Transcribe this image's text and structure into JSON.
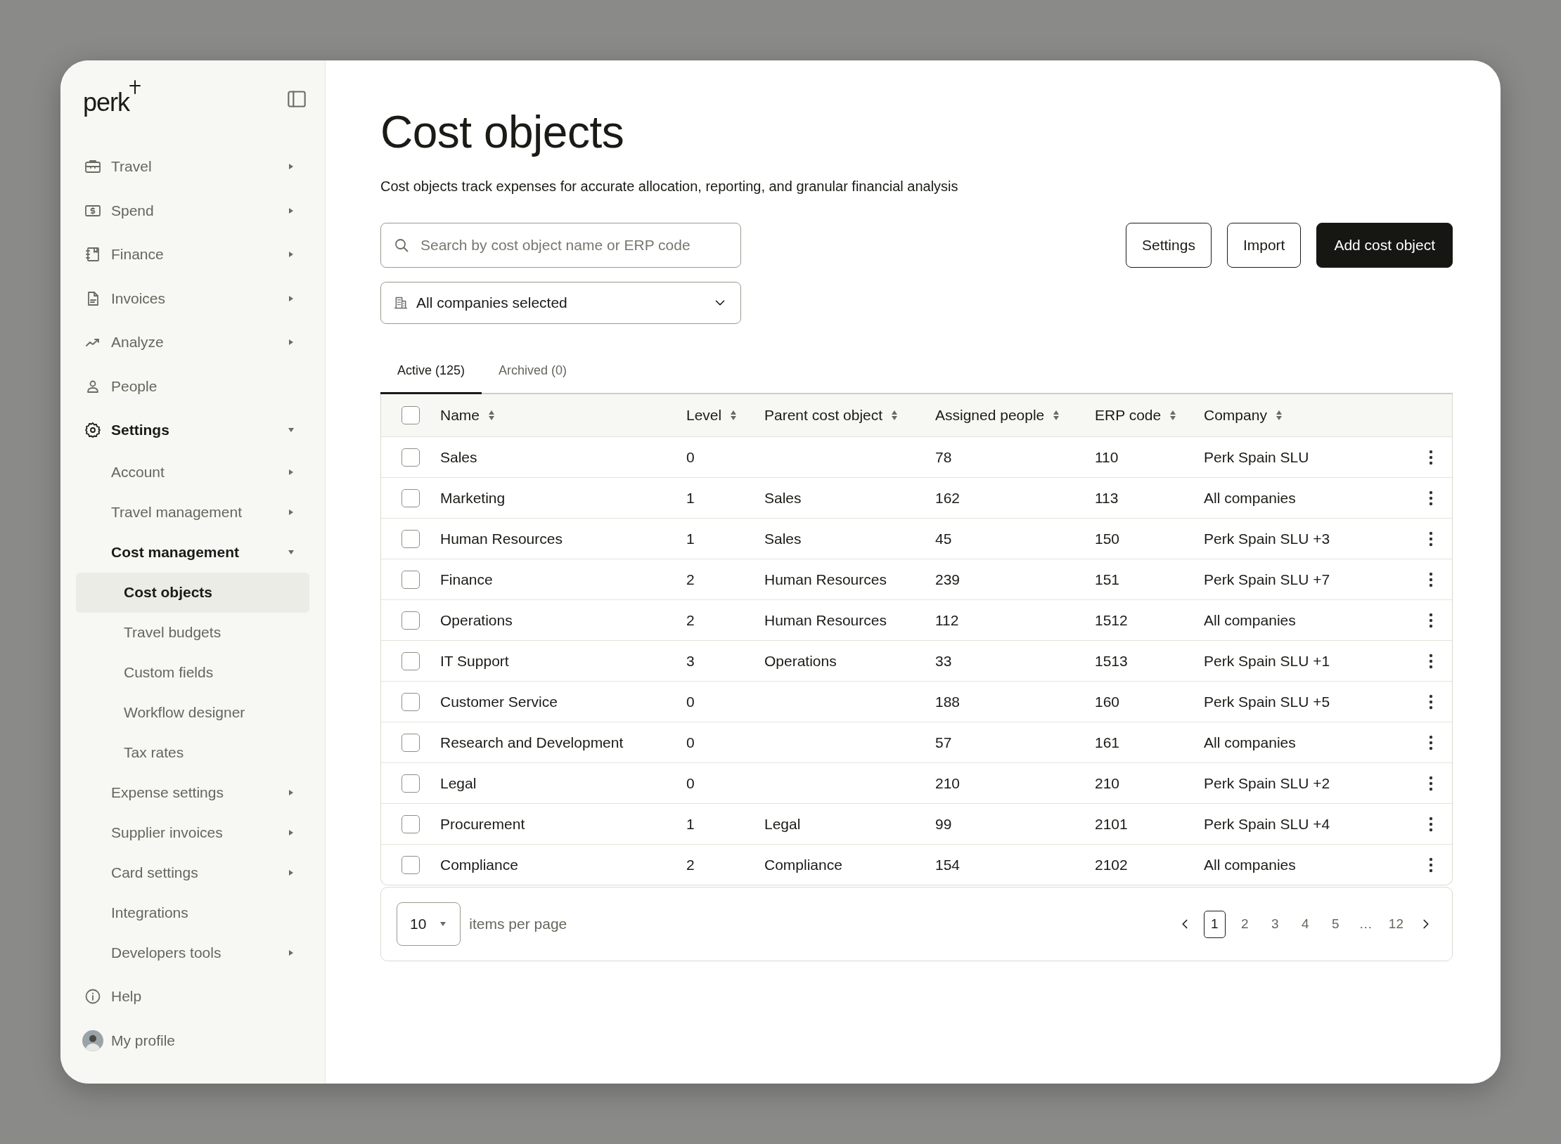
{
  "sidebar": {
    "logo": "perk",
    "items": [
      {
        "label": "Travel",
        "expanded": false,
        "selected": false
      },
      {
        "label": "Spend",
        "expanded": false,
        "selected": false
      },
      {
        "label": "Finance",
        "expanded": false,
        "selected": false
      },
      {
        "label": "Invoices",
        "expanded": false,
        "selected": false
      },
      {
        "label": "Analyze",
        "expanded": false,
        "selected": false
      },
      {
        "label": "People",
        "selected": false
      },
      {
        "label": "Settings",
        "expanded": true,
        "selected": false,
        "children": [
          {
            "label": "Account",
            "expanded": false,
            "selected": false
          },
          {
            "label": "Travel management",
            "expanded": false,
            "selected": false
          },
          {
            "label": "Cost management",
            "expanded": true,
            "selected": false,
            "children": [
              {
                "label": "Cost objects",
                "selected": true
              },
              {
                "label": "Travel budgets",
                "selected": false
              },
              {
                "label": "Custom fields",
                "selected": false
              },
              {
                "label": "Workflow designer",
                "selected": false
              },
              {
                "label": "Tax rates",
                "selected": false
              }
            ]
          },
          {
            "label": "Expense settings",
            "expanded": false,
            "selected": false
          },
          {
            "label": "Supplier invoices",
            "expanded": false,
            "selected": false
          },
          {
            "label": "Card settings",
            "expanded": false,
            "selected": false
          },
          {
            "label": "Integrations",
            "selected": false
          },
          {
            "label": "Developers tools",
            "expanded": false,
            "selected": false
          }
        ]
      }
    ],
    "footer": [
      {
        "kind": "help",
        "label": "Help"
      },
      {
        "kind": "profile",
        "label": "My profile"
      }
    ]
  },
  "page": {
    "title": "Cost objects",
    "description": "Cost objects track expenses for accurate allocation, reporting, and granular financial analysis"
  },
  "search": {
    "placeholder": "Search by cost object name or ERP code"
  },
  "company_filter": {
    "value": "All companies selected"
  },
  "buttons": [
    {
      "label": "Settings",
      "kind": "secondary"
    },
    {
      "label": "Import",
      "kind": "secondary"
    },
    {
      "label": "Add cost object",
      "kind": "primary"
    }
  ],
  "tabs": [
    {
      "label": "Active (125)",
      "selected": true
    },
    {
      "label": "Archived (0)",
      "selected": false
    }
  ],
  "table": {
    "select_all_checked": false,
    "columns": [
      "Name",
      "Level",
      "Parent cost object",
      "Assigned people",
      "ERP code",
      "Company"
    ],
    "rows": [
      {
        "checked": false,
        "cells": [
          "Sales",
          "0",
          "",
          "78",
          "110",
          "Perk Spain SLU"
        ]
      },
      {
        "checked": false,
        "cells": [
          "Marketing",
          "1",
          "Sales",
          "162",
          "113",
          "All companies"
        ]
      },
      {
        "checked": false,
        "cells": [
          "Human Resources",
          "1",
          "Sales",
          "45",
          "150",
          "Perk Spain SLU +3"
        ]
      },
      {
        "checked": false,
        "cells": [
          "Finance",
          "2",
          "Human Resources",
          "239",
          "151",
          "Perk Spain SLU +7"
        ]
      },
      {
        "checked": false,
        "cells": [
          "Operations",
          "2",
          "Human Resources",
          "112",
          "1512",
          "All companies"
        ]
      },
      {
        "checked": false,
        "cells": [
          "IT Support",
          "3",
          "Operations",
          "33",
          "1513",
          "Perk Spain SLU +1"
        ]
      },
      {
        "checked": false,
        "cells": [
          "Customer Service",
          "0",
          "",
          "188",
          "160",
          "Perk Spain SLU +5"
        ]
      },
      {
        "checked": false,
        "cells": [
          "Research and Development",
          "0",
          "",
          "57",
          "161",
          "All companies"
        ]
      },
      {
        "checked": false,
        "cells": [
          "Legal",
          "0",
          "",
          "210",
          "210",
          "Perk Spain SLU +2"
        ]
      },
      {
        "checked": false,
        "cells": [
          "Procurement",
          "1",
          "Legal",
          "99",
          "2101",
          "Perk Spain SLU +4"
        ]
      },
      {
        "checked": false,
        "cells": [
          "Compliance",
          "2",
          "Compliance",
          "154",
          "2102",
          "All companies"
        ]
      }
    ]
  },
  "pagination": {
    "per_page": "10",
    "per_page_label": "items per page",
    "pages": [
      {
        "label": "1",
        "selected": true
      },
      {
        "label": "2",
        "selected": false
      },
      {
        "label": "3",
        "selected": false
      },
      {
        "label": "4",
        "selected": false
      },
      {
        "label": "5",
        "selected": false
      },
      {
        "label": "…",
        "selected": false
      },
      {
        "label": "12",
        "selected": false
      }
    ]
  }
}
